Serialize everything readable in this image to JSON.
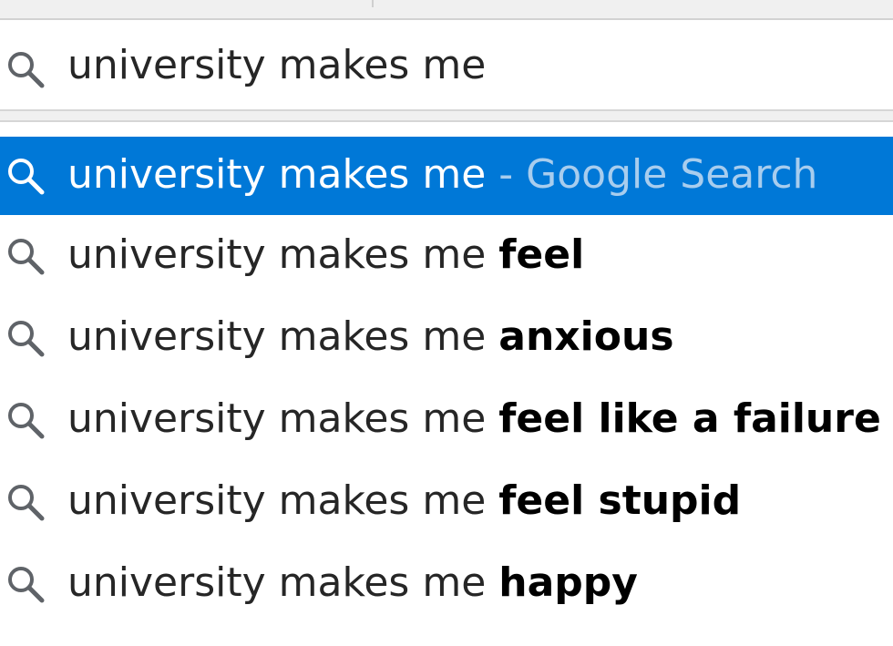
{
  "search": {
    "value": "university makes me",
    "placeholder": ""
  },
  "suggestions": {
    "top": {
      "prefix": "university makes me",
      "hint": " - Google Search"
    },
    "items": [
      {
        "prefix": "university makes me",
        "completion": "feel"
      },
      {
        "prefix": "university makes me",
        "completion": "anxious"
      },
      {
        "prefix": "university makes me",
        "completion": "feel like a failure"
      },
      {
        "prefix": "university makes me",
        "completion": "feel stupid"
      },
      {
        "prefix": "university makes me",
        "completion": "happy"
      }
    ]
  },
  "colors": {
    "highlight": "#0078d7",
    "highlight_text": "#ffffff",
    "hint_text": "#a8cdee",
    "text": "#262626",
    "icon": "#5f6368"
  },
  "icons": {
    "search": "magnifier"
  }
}
